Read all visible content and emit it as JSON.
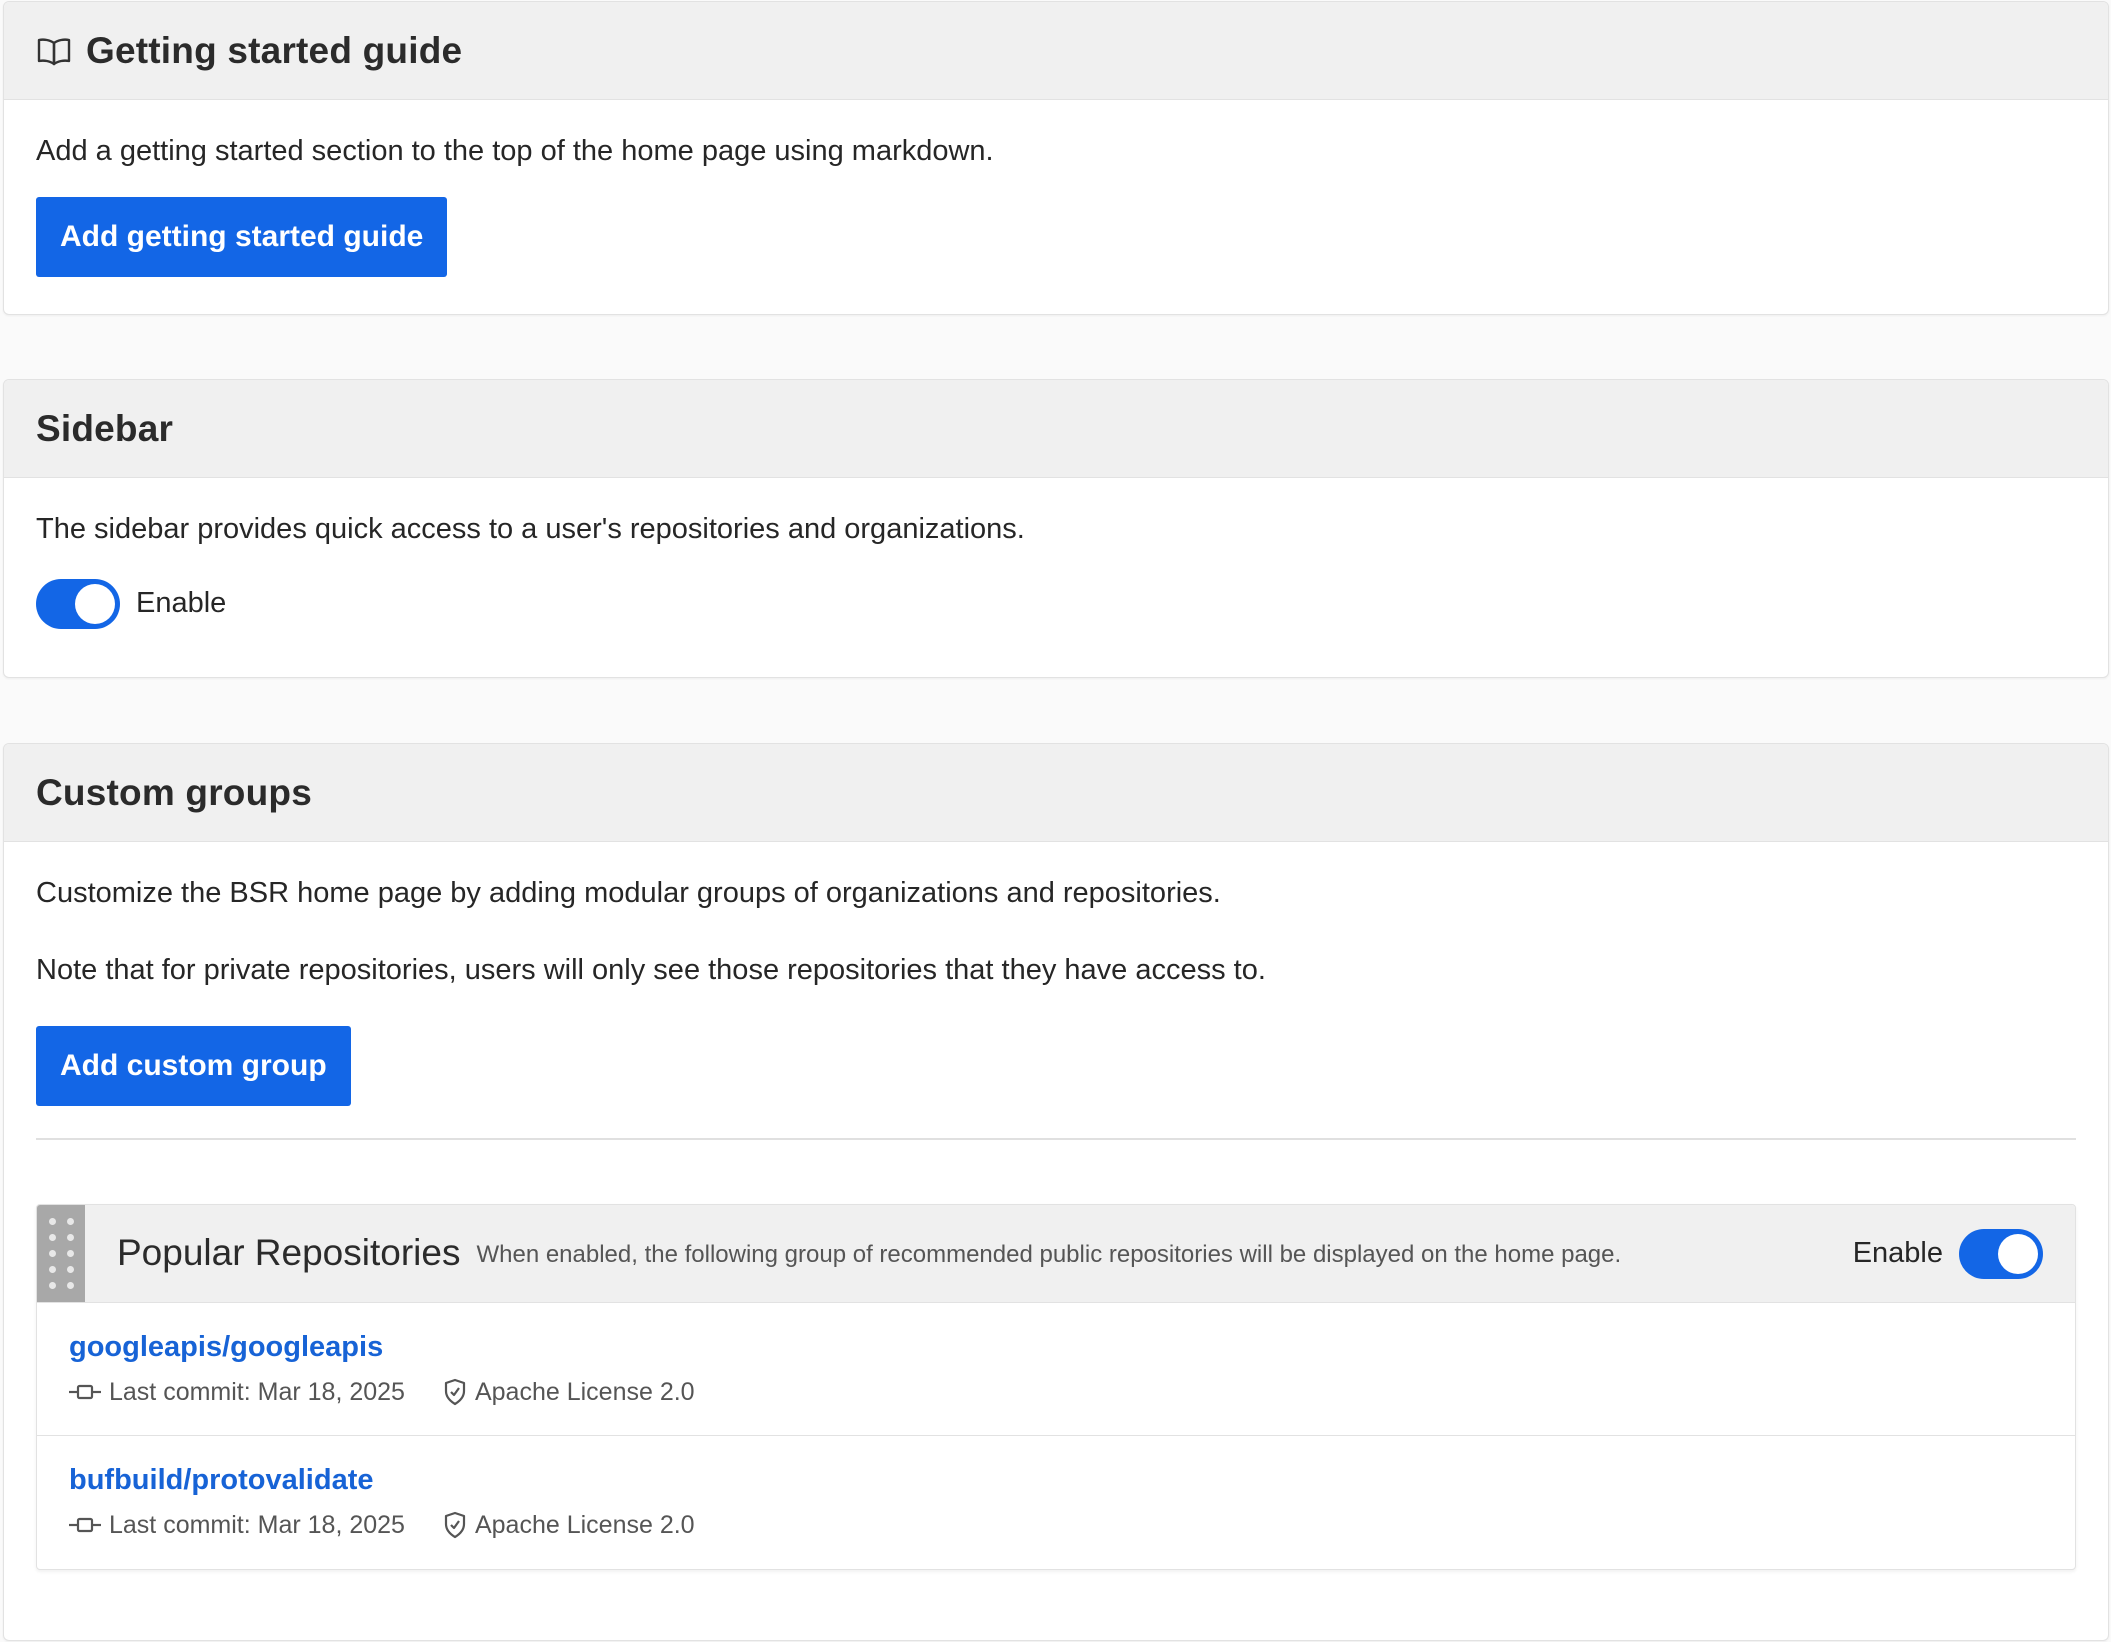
{
  "getting_started": {
    "title": "Getting started guide",
    "icon": "book-icon",
    "description": "Add a getting started section to the top of the home page using markdown.",
    "button_label": "Add getting started guide"
  },
  "sidebar": {
    "title": "Sidebar",
    "description": "The sidebar provides quick access to a user's repositories and organizations.",
    "toggle_label": "Enable",
    "toggle_on": true
  },
  "custom_groups": {
    "title": "Custom groups",
    "description": "Customize the BSR home page by adding modular groups of organizations and repositories.",
    "note": "Note that for private repositories, users will only see those repositories that they have access to.",
    "button_label": "Add custom group",
    "popular": {
      "title": "Popular Repositories",
      "description": "When enabled, the following group of recommended public repositories will be displayed on the home page.",
      "toggle_label": "Enable",
      "toggle_on": true,
      "repos": [
        {
          "name": "googleapis/googleapis",
          "last_commit": "Last commit: Mar 18, 2025",
          "license": "Apache License 2.0"
        },
        {
          "name": "bufbuild/protovalidate",
          "last_commit": "Last commit: Mar 18, 2025",
          "license": "Apache License 2.0"
        }
      ]
    }
  },
  "colors": {
    "accent": "#1366e6",
    "link": "#1763d6",
    "header_bg": "#f0f0f0"
  }
}
